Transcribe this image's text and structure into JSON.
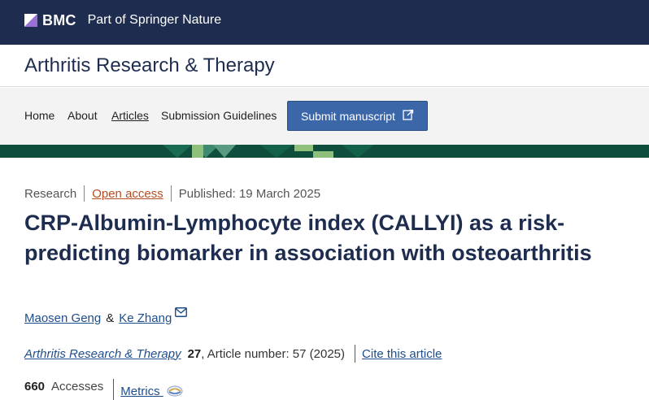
{
  "topbar": {
    "brand": "BMC",
    "tagline": "Part of Springer Nature",
    "background": "#1e2d4f"
  },
  "journal": {
    "title": "Arthritis Research & Therapy"
  },
  "nav": {
    "items": [
      {
        "label": "Home"
      },
      {
        "label": "About"
      },
      {
        "label": "Articles"
      },
      {
        "label": "Submission Guidelines"
      }
    ],
    "submit_label": "Submit manuscript",
    "submit_icon": "external-link-icon"
  },
  "article": {
    "type": "Research",
    "access": "Open access",
    "published": "Published: 19 March 2025",
    "title": "CRP-Albumin-Lymphocyte index (CALLYI) as a risk-predicting biomarker in association with osteoarthritis",
    "authors": [
      {
        "name": "Maosen Geng"
      },
      {
        "name": "Ke Zhang"
      }
    ],
    "author_separator": "&",
    "citation": {
      "journal": "Arthritis Research & Therapy",
      "volume": "27",
      "details": ", Article number: 57 (2025)",
      "cite_label": "Cite this article"
    },
    "metrics": {
      "accesses_count": "660",
      "accesses_label": "Accesses",
      "metrics_label": "Metrics"
    }
  },
  "colors": {
    "accent": "#3b66a8",
    "open_access": "#b84c21",
    "link": "#1e4d8c",
    "band": "#0f4d3c"
  }
}
